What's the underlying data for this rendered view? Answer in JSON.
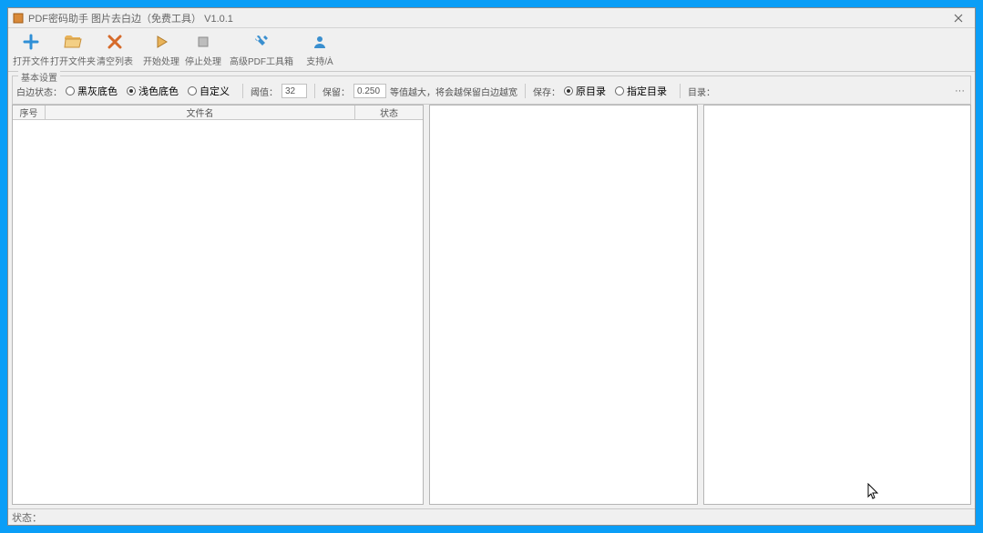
{
  "window": {
    "title": "PDF密码助手 图片去白边（免费工具） V1.0.1"
  },
  "toolbar": {
    "add_file": "打开文件",
    "add_folder": "打开文件夹",
    "clear_all": "清空列表",
    "start": "开始处理",
    "stop": "停止处理",
    "advanced": "高级PDF工具箱",
    "support": "支持/À"
  },
  "options": {
    "legend": "基本设置",
    "whitemode_label": "白边状态：",
    "radio1": "黑灰底色",
    "radio2": "浅色底色",
    "radio3": "自定义",
    "threshold_label": "阈值：",
    "threshold_value": "32",
    "margin_label": "保留：",
    "margin_value": "0.250",
    "note": "等值越大，将会越保留白边越宽",
    "output_label": "保存：",
    "out_radio1": "原目录",
    "out_radio2": "指定目录",
    "dir_label": "目录："
  },
  "table": {
    "col1": "序号",
    "col2": "文件名",
    "col3": "状态"
  },
  "status": {
    "label": "状态："
  }
}
